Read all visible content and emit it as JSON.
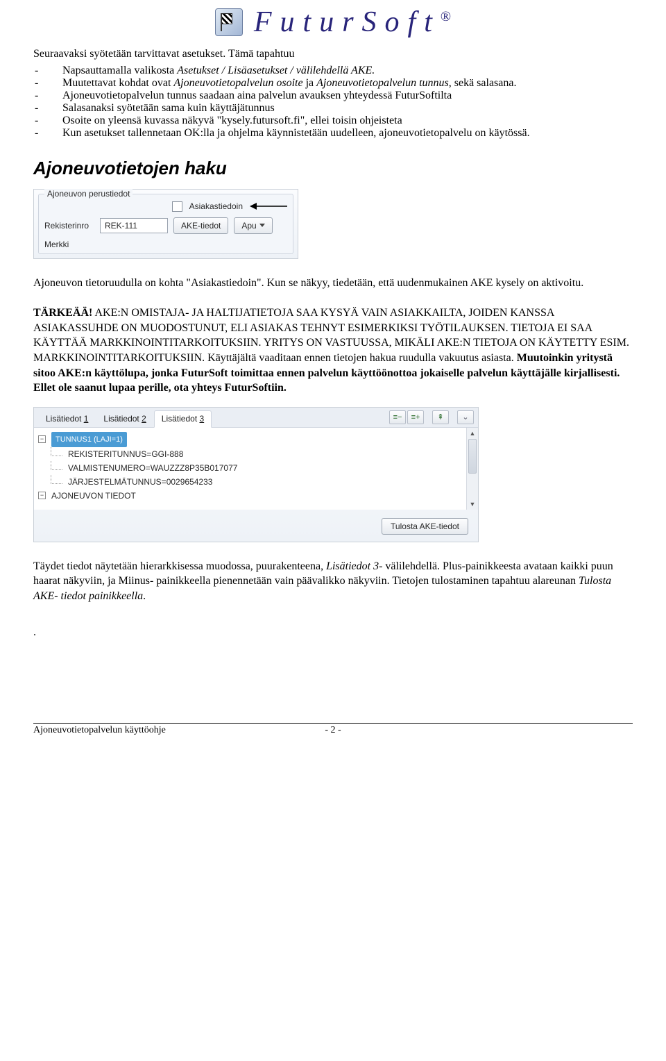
{
  "logo": {
    "text": "FuturSoft",
    "reg": "®"
  },
  "intro": {
    "line1": "Seuraavaksi syötetään tarvittavat asetukset. Tämä tapahtuu",
    "bullets": [
      {
        "pre": "Napsauttamalla valikosta ",
        "em": "Asetukset / Lisäasetukset / välilehdellä AKE.",
        "post": ""
      },
      {
        "pre": "Muutettavat kohdat ovat ",
        "em": "Ajoneuvotietopalvelun osoite",
        "mid": " ja ",
        "em2": "Ajoneuvotietopalvelun tunnus",
        "post": ", sekä salasana."
      },
      {
        "pre": "Ajoneuvotietopalvelun tunnus saadaan aina palvelun avauksen yhteydessä FuturSoftilta"
      },
      {
        "pre": "Salasanaksi syötetään sama kuin käyttäjätunnus"
      },
      {
        "pre": "Osoite on yleensä kuvassa näkyvä \"kysely.futursoft.fi\", ellei toisin ohjeisteta"
      },
      {
        "pre": "Kun asetukset tallennetaan OK:lla ja ohjelma käynnistetään uudelleen, ajoneuvotietopalvelu on käytössä."
      }
    ]
  },
  "section_title": "Ajoneuvotietojen haku",
  "shot1": {
    "group_legend": "Ajoneuvon perustiedot",
    "asiakastiedoin": "Asiakastiedoin",
    "rekisterinro_label": "Rekisterinro",
    "rekisterinro_value": "REK-111",
    "ake_tiedot": "AKE-tiedot",
    "apu": "Apu",
    "merkki_label": "Merkki"
  },
  "mid_para": {
    "l1a": "Ajoneuvon tietoruudulla on kohta \"Asiakastiedoin\". Kun se näkyy, tiedetään, että uudenmukainen AKE kysely on aktivoitu."
  },
  "warning": {
    "title": "TÄRKEÄÄ!",
    "body1": " AKE:N OMISTAJA- JA HALTIJATIETOJA SAA KYSYÄ VAIN ASIAKKAILTA, JOIDEN KANSSA ASIAKASSUHDE ON MUODOSTUNUT, ELI ASIAKAS TEHNYT ESIMERKIKSI TYÖTILAUKSEN. TIETOJA EI SAA KÄYTTÄÄ MARKKINOINTITARKOITUKSIIN. YRITYS ON VASTUUSSA, MIKÄLI AKE:N TIETOJA ON KÄYTETTY ESIM. MARKKINOINTITARKOITUKSIIN. Käyttäjältä vaaditaan ennen tietojen hakua ruudulla vakuutus asiasta. ",
    "bold2": "Muutoinkin yritystä sitoo AKE:n käyttölupa, jonka FuturSoft toimittaa ennen palvelun käyttöönottoa jokaiselle palvelun käyttäjälle kirjallisesti. Ellet ole saanut lupaa perille, ota yhteys FuturSoftiin."
  },
  "shot2": {
    "tabs": [
      "Lisätiedot ",
      "Lisätiedot ",
      "Lisätiedot "
    ],
    "tab_nums": [
      "1",
      "2",
      "3"
    ],
    "root_label": "TUNNUS1 (LAJI=1)",
    "children": [
      "REKISTERITUNNUS=GGI-888",
      "VALMISTENUMERO=WAUZZZ8P35B017077",
      "JÄRJESTELMÄTUNNUS=0029654233"
    ],
    "second_root": "AJONEUVON TIEDOT",
    "print_btn": "Tulosta AKE-tiedot"
  },
  "tail": {
    "p_a": "Täydet tiedot näytetään hierarkkisessa muodossa, puurakenteena, ",
    "p_em1": "Lisätiedot 3",
    "p_b": "- välilehdellä. Plus-painikkeesta avataan kaikki puun haarat näkyviin, ja Miinus- painikkeella pienennetään vain päävalikko näkyviin. Tietojen tulostaminen tapahtuu alareunan ",
    "p_em2": "Tulosta AKE- tiedot painikkeella",
    "p_c": "."
  },
  "footer": {
    "left": "Ajoneuvotietopalvelun käyttöohje",
    "center": "- 2 -"
  }
}
